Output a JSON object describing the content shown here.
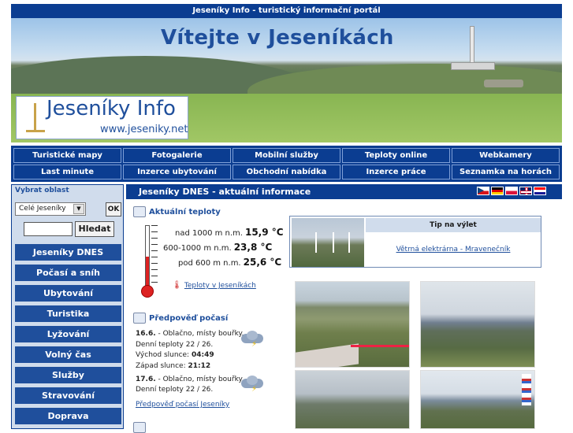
{
  "header": {
    "title": "Jeseníky Info - turistický informační portál",
    "banner_title": "Vítejte v Jeseníkách",
    "logo_name": "Jeseníky Info",
    "logo_url": "www.jeseniky.net"
  },
  "nav": {
    "row1": [
      "Turistické mapy",
      "Fotogalerie",
      "Mobilní služby",
      "Teploty online",
      "Webkamery"
    ],
    "row2": [
      "Last minute",
      "Inzerce ubytování",
      "Obchodní nabídka",
      "Inzerce práce",
      "Seznamka na horách"
    ]
  },
  "sidebar": {
    "region_label": "Vybrat oblast",
    "region_selected": "Celé Jeseníky",
    "ok_label": "OK",
    "search_value": "",
    "search_button": "Hledat",
    "menu": [
      "Jeseníky DNES",
      "Počasí a sníh",
      "Ubytování",
      "Turistika",
      "Lyžování",
      "Volný čas",
      "Služby",
      "Stravování",
      "Doprava"
    ]
  },
  "content": {
    "heading": "Jeseníky DNES - aktuální informace",
    "flags": [
      "cz-flag",
      "de-flag",
      "pl-flag",
      "gb-flag",
      "hr-flag"
    ],
    "temps": {
      "title": "Aktuální teploty",
      "rows": [
        {
          "label": "nad 1000 m n.m.",
          "value": "15,9 °C"
        },
        {
          "label": "600-1000 m n.m.",
          "value": "23,8 °C"
        },
        {
          "label": "pod 600 m n.m.",
          "value": "25,6 °C"
        }
      ],
      "link": "Teploty v Jeseníkách"
    },
    "forecast": {
      "title": "Předpověď počasí",
      "day1_line1_date": "16.6.",
      "day1_line1_text": " - Oblačno, místy bouřky.",
      "day1_line2": "Denní teploty 22 / 26.",
      "day1_line3_label": "Východ slunce: ",
      "day1_line3_value": "04:49",
      "day1_line4_label": "Západ slunce: ",
      "day1_line4_value": "21:12",
      "day2_line1_date": "17.6.",
      "day2_line1_text": " - Oblačno, místy bouřky.",
      "day2_line2": "Denní teploty 22 / 26.",
      "link": "Předpověď počasí Jeseníky"
    },
    "tip": {
      "heading": "Tip na výlet",
      "link": "Větrná elektrárna - Mravenečník"
    }
  },
  "colors": {
    "brand_blue": "#0b3d91",
    "menu_blue": "#1f4f9c",
    "sidebar_bg": "#d0dcec"
  }
}
